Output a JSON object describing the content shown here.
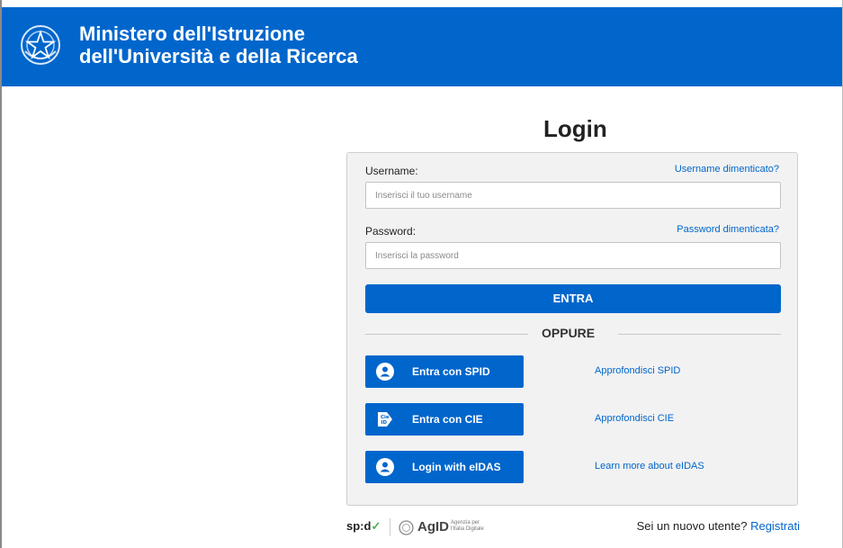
{
  "header": {
    "title_line1": "Ministero dell'Istruzione",
    "title_line2": "dell'Università e della Ricerca",
    "emblem_icon": "italian-republic-emblem-icon"
  },
  "login": {
    "title": "Login",
    "username_label": "Username:",
    "username_forgot": "Username dimenticato?",
    "username_placeholder": "Inserisci il tuo username",
    "password_label": "Password:",
    "password_forgot": "Password dimenticata?",
    "password_placeholder": "Inserisci la password",
    "enter_button": "ENTRA",
    "or_text": "OPPURE"
  },
  "alt_logins": [
    {
      "label": "Entra con SPID",
      "icon": "spid-user-icon",
      "more": "Approfondisci SPID"
    },
    {
      "label": "Entra con CIE",
      "icon": "cie-id-icon",
      "more": "Approfondisci CIE"
    },
    {
      "label": "Login with eIDAS",
      "icon": "eidas-user-icon",
      "more": "Learn more about eIDAS"
    }
  ],
  "footer": {
    "spid_logo": "sp:d",
    "agid_logo": "AgID",
    "agid_sub": "Agenzia per l'Italia Digitale",
    "signup_text": "Sei un nuovo utente?",
    "signup_link": "Registrati"
  },
  "colors": {
    "brand_blue": "#0066cc",
    "panel_bg": "#f2f2f2"
  }
}
